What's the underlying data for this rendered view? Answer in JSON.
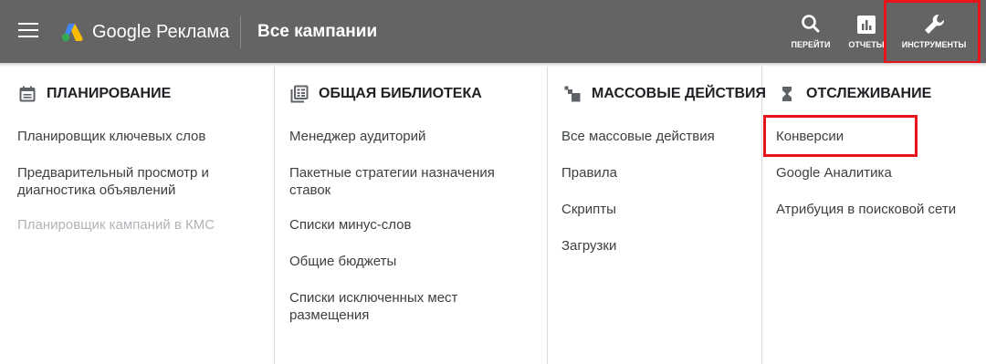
{
  "header": {
    "brand": "Google Реклама",
    "title": "Все кампании",
    "tools": [
      {
        "label": "ПЕРЕЙТИ",
        "icon": "search-icon"
      },
      {
        "label": "ОТЧЕТЫ",
        "icon": "bar-chart-icon"
      },
      {
        "label": "ИНСТРУМЕНТЫ",
        "icon": "wrench-icon"
      }
    ]
  },
  "columns": [
    {
      "title": "ПЛАНИРОВАНИЕ",
      "icon": "calendar-icon",
      "items": [
        {
          "label": "Планировщик ключевых слов"
        },
        {
          "label": "Предварительный просмотр и диагностика объявлений"
        },
        {
          "label": "Планировщик кампаний в КМС",
          "disabled": true
        }
      ]
    },
    {
      "title": "ОБЩАЯ БИБЛИОТЕКА",
      "icon": "library-icon",
      "items": [
        {
          "label": "Менеджер аудиторий"
        },
        {
          "label": "Пакетные стратегии назначения ставок"
        },
        {
          "label": "Списки минус-слов"
        },
        {
          "label": "Общие бюджеты"
        },
        {
          "label": "Списки исключенных мест размещения"
        }
      ]
    },
    {
      "title": "МАССОВЫЕ ДЕЙСТВИЯ",
      "icon": "copies-icon",
      "items": [
        {
          "label": "Все массовые действия"
        },
        {
          "label": "Правила"
        },
        {
          "label": "Скрипты"
        },
        {
          "label": "Загрузки"
        }
      ]
    },
    {
      "title": "ОТСЛЕЖИВАНИЕ",
      "icon": "hourglass-icon",
      "items": [
        {
          "label": "Конверсии"
        },
        {
          "label": "Google Аналитика"
        },
        {
          "label": "Атрибуция в поисковой сети"
        }
      ]
    }
  ],
  "colors": {
    "topbar": "#646464",
    "highlight": "#e8141c",
    "disabled_text": "#b0b3b8"
  }
}
